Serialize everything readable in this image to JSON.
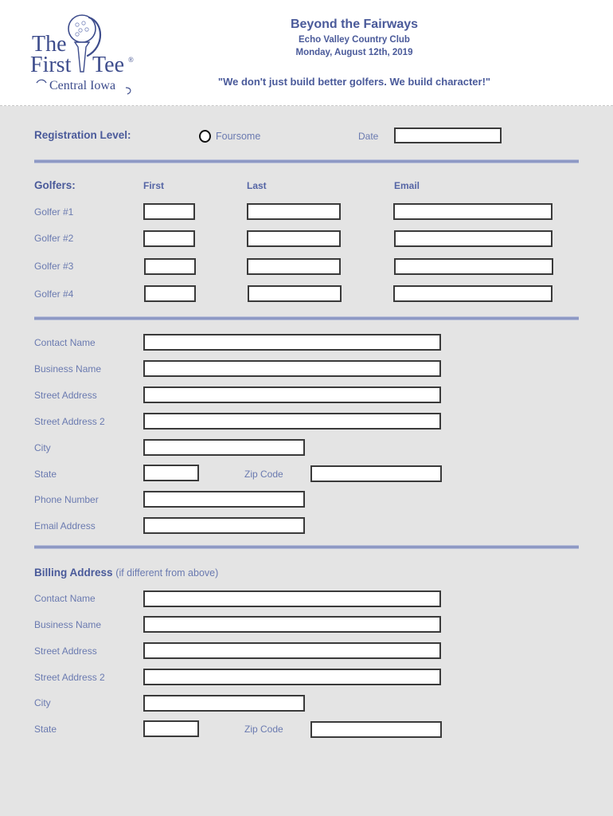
{
  "header": {
    "logo": {
      "line1": "The",
      "line2": "First",
      "line3": "Tee",
      "registered": "®",
      "chapter": "Central Iowa"
    },
    "title": "Beyond the Fairways",
    "venue": "Echo Valley Country Club",
    "date": "Monday, August 12th, 2019",
    "tagline": "\"We don't just build better golfers.  We build character!\""
  },
  "registration": {
    "heading": "Registration Level:",
    "option_label": "Foursome",
    "option_checked": false,
    "date_label": "Date",
    "date_value": "",
    "date_placeholder": ""
  },
  "golfers": {
    "heading": "Golfers:",
    "columns": [
      "First",
      "Last",
      "Email"
    ],
    "rows": [
      {
        "label": "Golfer #1",
        "first": "",
        "last": "",
        "email": ""
      },
      {
        "label": "Golfer #2",
        "first": "",
        "last": "",
        "email": ""
      },
      {
        "label": "Golfer #3",
        "first": "",
        "last": "",
        "email": ""
      },
      {
        "label": "Golfer #4",
        "first": "",
        "last": "",
        "email": ""
      }
    ]
  },
  "contact": {
    "fields": [
      {
        "label": "Contact Name",
        "value": ""
      },
      {
        "label": "Business Name",
        "value": ""
      },
      {
        "label": "Street Address",
        "value": ""
      },
      {
        "label": "Street Address 2",
        "value": ""
      },
      {
        "label": "City",
        "value": ""
      },
      {
        "label": "State",
        "value": ""
      },
      {
        "label": "Phone Number",
        "value": ""
      },
      {
        "label": "Email Address",
        "value": ""
      }
    ],
    "zip_label": "Zip Code",
    "zip_value": ""
  },
  "billing": {
    "heading": "Billing Address",
    "note": "(if different from above)",
    "fields": [
      {
        "label": "Contact Name",
        "value": ""
      },
      {
        "label": "Business Name",
        "value": ""
      },
      {
        "label": "Street Address",
        "value": ""
      },
      {
        "label": "Street Address 2",
        "value": ""
      },
      {
        "label": "City",
        "value": ""
      },
      {
        "label": "State",
        "value": ""
      }
    ],
    "zip_label": "Zip Code",
    "zip_value": ""
  },
  "colors": {
    "page_background": "#e4e4e4",
    "header_background": "#ffffff",
    "brand_blue": "#4a5a9a",
    "label_blue": "#6a7ab0",
    "divider": "#8e99c4",
    "field_border": "#3a3a3a"
  }
}
